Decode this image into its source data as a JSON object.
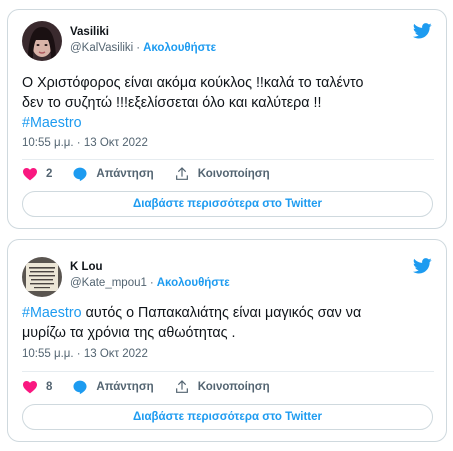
{
  "brand_color": "#1d9bf0",
  "tweets": [
    {
      "author": "Vasiliki",
      "handle": "@KalVasiliki",
      "separator": "·",
      "follow_label": "Ακολουθήστε",
      "text_lines": [
        "Ο Χριστόφορος είναι ακόμα κούκλος !!καλά το ταλέντο",
        "δεν το συζητώ !!!εξελίσσεται όλο και καλύτερα !!"
      ],
      "hashtag": "#Maestro",
      "timestamp": "10:55 μ.μ. · 13 Οκτ 2022",
      "like_count": "2",
      "reply_label": "Απάντηση",
      "share_label": "Κοινοποίηση",
      "read_more_label": "Διαβάστε περισσότερα στο Twitter",
      "icons": [
        "avatar-photo",
        "twitter-bird-icon",
        "heart-icon",
        "reply-bubble-icon",
        "share-icon"
      ]
    },
    {
      "author": "K Lou",
      "handle": "@Kate_mpou1",
      "separator": "·",
      "follow_label": "Ακολουθήστε",
      "hashtag": "#Maestro",
      "text_after_hashtag": " αυτός ο Παπακαλιάτης είναι μαγικός σαν να",
      "text_line2": "μυρίζω τα χρόνια της αθωότητας .",
      "timestamp": "10:55 μ.μ. · 13 Οκτ 2022",
      "like_count": "8",
      "reply_label": "Απάντηση",
      "share_label": "Κοινοποίηση",
      "read_more_label": "Διαβάστε περισσότερα στο Twitter",
      "icons": [
        "avatar-text-image",
        "twitter-bird-icon",
        "heart-icon",
        "reply-bubble-icon",
        "share-icon"
      ]
    }
  ]
}
